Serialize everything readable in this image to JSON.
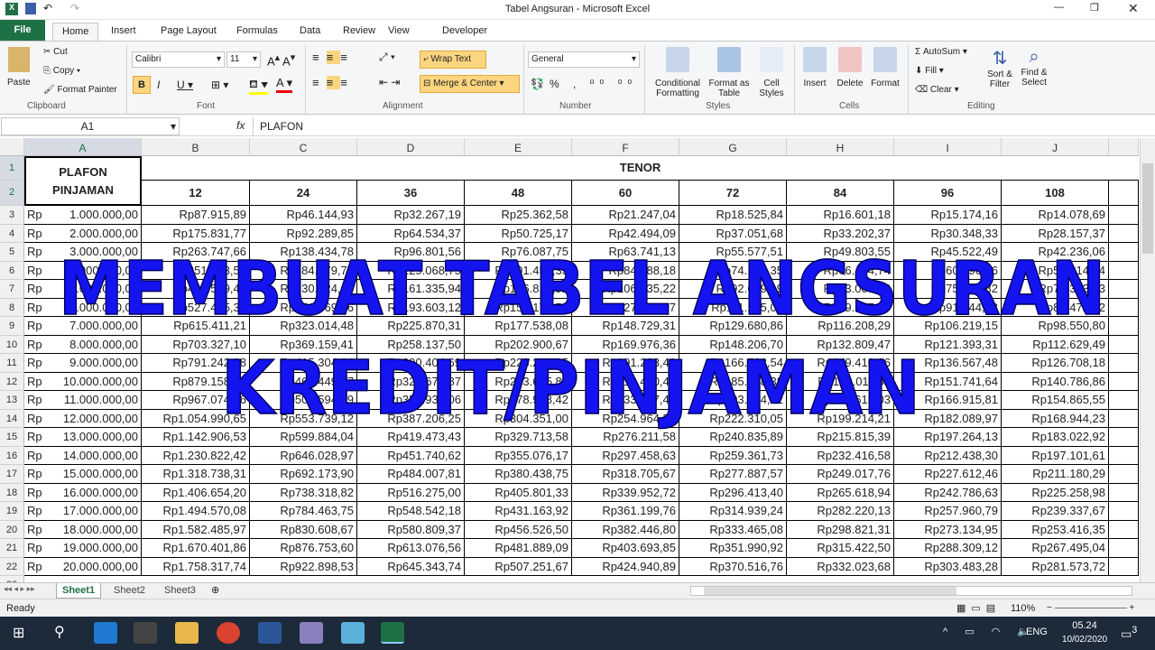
{
  "window": {
    "title": "Tabel Angsuran  -  Microsoft Excel"
  },
  "tabs": [
    "File",
    "Home",
    "Insert",
    "Page Layout",
    "Formulas",
    "Data",
    "Review",
    "View",
    "Developer"
  ],
  "ribbon": {
    "clipboard": {
      "paste": "Paste",
      "cut": "Cut",
      "copy": "Copy",
      "format_painter": "Format Painter",
      "label": "Clipboard"
    },
    "font": {
      "name": "Calibri",
      "size": "11",
      "label": "Font"
    },
    "alignment": {
      "wrap": "Wrap Text",
      "merge": "Merge & Center",
      "label": "Alignment"
    },
    "number": {
      "format": "General",
      "label": "Number"
    },
    "styles": {
      "cond": "Conditional Formatting",
      "table": "Format as Table",
      "cell": "Cell Styles",
      "label": "Styles"
    },
    "cells": {
      "insert": "Insert",
      "delete": "Delete",
      "format": "Format",
      "label": "Cells"
    },
    "editing": {
      "autosum": "AutoSum",
      "fill": "Fill",
      "clear": "Clear",
      "sort": "Sort & Filter",
      "find": "Find & Select",
      "label": "Editing"
    }
  },
  "formula_bar": {
    "name_box": "A1",
    "fx": "fx",
    "value": "PLAFON"
  },
  "columns": [
    "A",
    "B",
    "C",
    "D",
    "E",
    "F",
    "G",
    "H",
    "I",
    "J"
  ],
  "header": {
    "plafon": "PLAFON PINJAMAN",
    "tenor": "TENOR",
    "tenors": [
      "12",
      "24",
      "36",
      "48",
      "60",
      "72",
      "84",
      "96",
      "108"
    ]
  },
  "rows": [
    {
      "n": "3",
      "cur": "Rp",
      "plafon": "1.000.000,00",
      "v": [
        "Rp87.915,89",
        "Rp46.144,93",
        "Rp32.267,19",
        "Rp25.362,58",
        "Rp21.247,04",
        "Rp18.525,84",
        "Rp16.601,18",
        "Rp15.174,16",
        "Rp14.078,69"
      ]
    },
    {
      "n": "4",
      "cur": "Rp",
      "plafon": "2.000.000,00",
      "v": [
        "Rp175.831,77",
        "Rp92.289,85",
        "Rp64.534,37",
        "Rp50.725,17",
        "Rp42.494,09",
        "Rp37.051,68",
        "Rp33.202,37",
        "Rp30.348,33",
        "Rp28.157,37"
      ]
    },
    {
      "n": "5",
      "cur": "Rp",
      "plafon": "3.000.000,00",
      "v": [
        "Rp263.747,66",
        "Rp138.434,78",
        "Rp96.801,56",
        "Rp76.087,75",
        "Rp63.741,13",
        "Rp55.577,51",
        "Rp49.803,55",
        "Rp45.522,49",
        "Rp42.236,06"
      ]
    },
    {
      "n": "6",
      "cur": "Rp",
      "plafon": "4.000.000,00",
      "v": [
        "Rp351.663,55",
        "Rp184.579,71",
        "Rp129.068,75",
        "Rp101.450,33",
        "Rp84.988,18",
        "Rp74.103,35",
        "Rp66.404,74",
        "Rp60.696,66",
        "Rp56.314,74"
      ]
    },
    {
      "n": "7",
      "cur": "Rp",
      "plafon": "5.000.000,00",
      "v": [
        "Rp439.579,44",
        "Rp230.724,63",
        "Rp161.335,94",
        "Rp126.812,92",
        "Rp106.235,22",
        "Rp92.629,19",
        "Rp83.005,92",
        "Rp75.870,82",
        "Rp70.393,43"
      ]
    },
    {
      "n": "8",
      "cur": "Rp",
      "plafon": "6.000.000,00",
      "v": [
        "Rp527.495,32",
        "Rp276.869,56",
        "Rp193.603,12",
        "Rp152.175,50",
        "Rp127.482,27",
        "Rp111.155,03",
        "Rp99.607,10",
        "Rp91.044,98",
        "Rp84.472,12"
      ]
    },
    {
      "n": "9",
      "cur": "Rp",
      "plafon": "7.000.000,00",
      "v": [
        "Rp615.411,21",
        "Rp323.014,48",
        "Rp225.870,31",
        "Rp177.538,08",
        "Rp148.729,31",
        "Rp129.680,86",
        "Rp116.208,29",
        "Rp106.219,15",
        "Rp98.550,80"
      ]
    },
    {
      "n": "10",
      "cur": "Rp",
      "plafon": "8.000.000,00",
      "v": [
        "Rp703.327,10",
        "Rp369.159,41",
        "Rp258.137,50",
        "Rp202.900,67",
        "Rp169.976,36",
        "Rp148.206,70",
        "Rp132.809,47",
        "Rp121.393,31",
        "Rp112.629,49"
      ]
    },
    {
      "n": "11",
      "cur": "Rp",
      "plafon": "9.000.000,00",
      "v": [
        "Rp791.242,98",
        "Rp415.304,34",
        "Rp290.404,69",
        "Rp228.263,25",
        "Rp191.223,40",
        "Rp166.732,54",
        "Rp149.410,66",
        "Rp136.567,48",
        "Rp126.708,18"
      ]
    },
    {
      "n": "12",
      "cur": "Rp",
      "plafon": "10.000.000,00",
      "v": [
        "Rp879.158,87",
        "Rp461.449,27",
        "Rp322.671,87",
        "Rp253.625,83",
        "Rp212.470,45",
        "Rp185.258,38",
        "Rp166.011,84",
        "Rp151.741,64",
        "Rp140.786,86"
      ]
    },
    {
      "n": "13",
      "cur": "Rp",
      "plafon": "11.000.000,00",
      "v": [
        "Rp967.074,76",
        "Rp507.594,19",
        "Rp354.939,06",
        "Rp278.988,42",
        "Rp233.717,49",
        "Rp203.784,22",
        "Rp182.613,03",
        "Rp166.915,81",
        "Rp154.865,55"
      ]
    },
    {
      "n": "14",
      "cur": "Rp",
      "plafon": "12.000.000,00",
      "v": [
        "Rp1.054.990,65",
        "Rp553.739,12",
        "Rp387.206,25",
        "Rp304.351,00",
        "Rp254.964,54",
        "Rp222.310,05",
        "Rp199.214,21",
        "Rp182.089,97",
        "Rp168.944,23"
      ]
    },
    {
      "n": "15",
      "cur": "Rp",
      "plafon": "13.000.000,00",
      "v": [
        "Rp1.142.906,53",
        "Rp599.884,04",
        "Rp419.473,43",
        "Rp329.713,58",
        "Rp276.211,58",
        "Rp240.835,89",
        "Rp215.815,39",
        "Rp197.264,13",
        "Rp183.022,92"
      ]
    },
    {
      "n": "16",
      "cur": "Rp",
      "plafon": "14.000.000,00",
      "v": [
        "Rp1.230.822,42",
        "Rp646.028,97",
        "Rp451.740,62",
        "Rp355.076,17",
        "Rp297.458,63",
        "Rp259.361,73",
        "Rp232.416,58",
        "Rp212.438,30",
        "Rp197.101,61"
      ]
    },
    {
      "n": "17",
      "cur": "Rp",
      "plafon": "15.000.000,00",
      "v": [
        "Rp1.318.738,31",
        "Rp692.173,90",
        "Rp484.007,81",
        "Rp380.438,75",
        "Rp318.705,67",
        "Rp277.887,57",
        "Rp249.017,76",
        "Rp227.612,46",
        "Rp211.180,29"
      ]
    },
    {
      "n": "18",
      "cur": "Rp",
      "plafon": "16.000.000,00",
      "v": [
        "Rp1.406.654,20",
        "Rp738.318,82",
        "Rp516.275,00",
        "Rp405.801,33",
        "Rp339.952,72",
        "Rp296.413,40",
        "Rp265.618,94",
        "Rp242.786,63",
        "Rp225.258,98"
      ]
    },
    {
      "n": "19",
      "cur": "Rp",
      "plafon": "17.000.000,00",
      "v": [
        "Rp1.494.570,08",
        "Rp784.463,75",
        "Rp548.542,18",
        "Rp431.163,92",
        "Rp361.199,76",
        "Rp314.939,24",
        "Rp282.220,13",
        "Rp257.960,79",
        "Rp239.337,67"
      ]
    },
    {
      "n": "20",
      "cur": "Rp",
      "plafon": "18.000.000,00",
      "v": [
        "Rp1.582.485,97",
        "Rp830.608,67",
        "Rp580.809,37",
        "Rp456.526,50",
        "Rp382.446,80",
        "Rp333.465,08",
        "Rp298.821,31",
        "Rp273.134,95",
        "Rp253.416,35"
      ]
    },
    {
      "n": "21",
      "cur": "Rp",
      "plafon": "19.000.000,00",
      "v": [
        "Rp1.670.401,86",
        "Rp876.753,60",
        "Rp613.076,56",
        "Rp481.889,09",
        "Rp403.693,85",
        "Rp351.990,92",
        "Rp315.422,50",
        "Rp288.309,12",
        "Rp267.495,04"
      ]
    },
    {
      "n": "22",
      "cur": "Rp",
      "plafon": "20.000.000,00",
      "v": [
        "Rp1.758.317,74",
        "Rp922.898,53",
        "Rp645.343,74",
        "Rp507.251,67",
        "Rp424.940,89",
        "Rp370.516,76",
        "Rp332.023,68",
        "Rp303.483,28",
        "Rp281.573,72"
      ]
    }
  ],
  "overlay": {
    "line1": "MEMBUAT TABEL ANGSURAN",
    "line2": "KREDIT/PINJAMAN",
    "color": "#1414f0"
  },
  "sheets": [
    "Sheet1",
    "Sheet2",
    "Sheet3"
  ],
  "status": {
    "ready": "Ready",
    "zoom": "110%"
  },
  "taskbar": {
    "lang": "ENG",
    "time": "05.24",
    "date": "10/02/2020",
    "notif": "3"
  },
  "colors": {
    "excel_green": "#1e7145",
    "highlight": "#fcd580"
  }
}
